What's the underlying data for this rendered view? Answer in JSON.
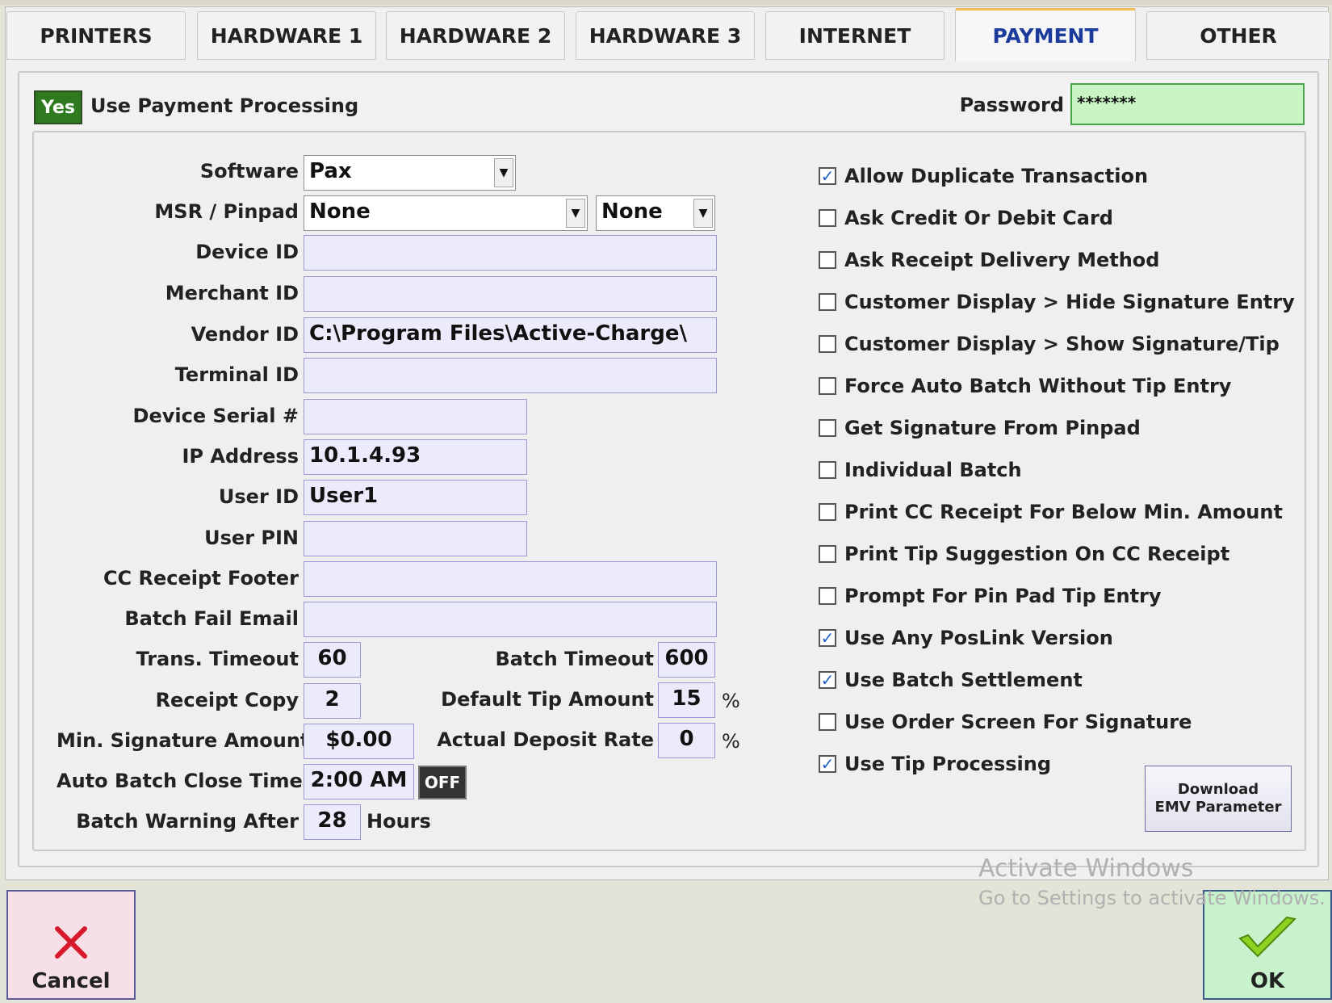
{
  "tabs": [
    "PRINTERS",
    "HARDWARE 1",
    "HARDWARE 2",
    "HARDWARE 3",
    "INTERNET",
    "PAYMENT",
    "OTHER"
  ],
  "active_tab": "PAYMENT",
  "header": {
    "use_toggle": "Yes",
    "use_label": "Use Payment Processing",
    "password_label": "Password",
    "password_value": "*******"
  },
  "form": {
    "software_label": "Software",
    "software_value": "Pax",
    "msr_label": "MSR / Pinpad",
    "msr_value": "None",
    "msr_value2": "None",
    "device_id_label": "Device ID",
    "device_id_value": "",
    "merchant_id_label": "Merchant ID",
    "merchant_id_value": "",
    "vendor_id_label": "Vendor ID",
    "vendor_id_value": "C:\\Program Files\\Active-Charge\\",
    "terminal_id_label": "Terminal ID",
    "terminal_id_value": "",
    "device_serial_label": "Device Serial #",
    "device_serial_value": "",
    "ip_label": "IP Address",
    "ip_value": "10.1.4.93",
    "user_id_label": "User ID",
    "user_id_value": "User1",
    "user_pin_label": "User PIN",
    "user_pin_value": "",
    "cc_footer_label": "CC Receipt Footer",
    "cc_footer_value": "",
    "batch_fail_label": "Batch Fail Email",
    "batch_fail_value": "",
    "trans_timeout_label": "Trans. Timeout",
    "trans_timeout_value": "60",
    "batch_timeout_label": "Batch Timeout",
    "batch_timeout_value": "600",
    "receipt_copy_label": "Receipt Copy",
    "receipt_copy_value": "2",
    "default_tip_label": "Default Tip Amount",
    "default_tip_value": "15",
    "percent": "%",
    "min_sig_label": "Min. Signature Amount",
    "min_sig_value": "$0.00",
    "deposit_rate_label": "Actual Deposit Rate",
    "deposit_rate_value": "0",
    "auto_batch_label": "Auto Batch Close Time",
    "auto_batch_value": "2:00 AM",
    "auto_batch_toggle": "OFF",
    "batch_warning_label": "Batch Warning After",
    "batch_warning_value": "28",
    "hours_label": "Hours"
  },
  "options": [
    {
      "label": "Allow Duplicate Transaction",
      "checked": true
    },
    {
      "label": "Ask Credit Or Debit Card",
      "checked": false
    },
    {
      "label": "Ask Receipt Delivery Method",
      "checked": false
    },
    {
      "label": "Customer Display > Hide Signature Entry",
      "checked": false
    },
    {
      "label": "Customer Display > Show Signature/Tip",
      "checked": false
    },
    {
      "label": "Force Auto Batch Without Tip Entry",
      "checked": false
    },
    {
      "label": "Get Signature From Pinpad",
      "checked": false
    },
    {
      "label": "Individual Batch",
      "checked": false
    },
    {
      "label": "Print CC Receipt For Below Min. Amount",
      "checked": false
    },
    {
      "label": "Print Tip Suggestion On CC Receipt",
      "checked": false
    },
    {
      "label": "Prompt For Pin Pad Tip Entry",
      "checked": false
    },
    {
      "label": "Use Any PosLink Version",
      "checked": true
    },
    {
      "label": "Use Batch Settlement",
      "checked": true
    },
    {
      "label": "Use Order Screen For Signature",
      "checked": false
    },
    {
      "label": "Use Tip Processing",
      "checked": true
    }
  ],
  "download_button": {
    "line1": "Download",
    "line2": "EMV Parameter"
  },
  "cancel_label": "Cancel",
  "ok_label": "OK",
  "watermark": {
    "line1": "Activate Windows",
    "line2": "Go to Settings to activate Windows."
  },
  "colors": {
    "yes_green": "#2f7a1f",
    "password_bg": "#c9f5c4",
    "active_tab_text": "#1a3a9c",
    "cancel_bg": "#f7dfe8",
    "ok_bg": "#c8f2cc"
  }
}
